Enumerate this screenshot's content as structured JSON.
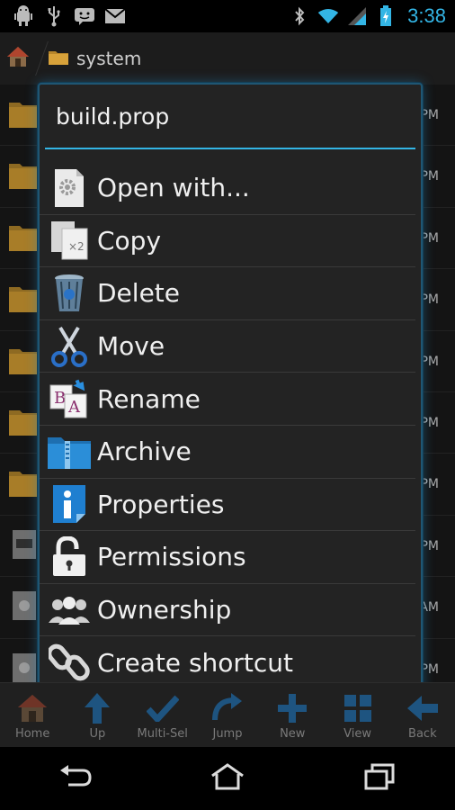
{
  "status_bar": {
    "time": "3:38",
    "icons": [
      "android-debug-icon",
      "usb-icon",
      "messenger-icon",
      "gmail-icon",
      "bluetooth-icon",
      "wifi-icon",
      "signal-icon",
      "battery-charging-icon"
    ]
  },
  "path_bar": {
    "segments": [
      {
        "label": "system",
        "icon": "folder-icon"
      }
    ]
  },
  "file_list": {
    "rows": [
      {
        "time": "PM",
        "type": "folder"
      },
      {
        "time": "PM",
        "type": "folder"
      },
      {
        "time": "PM",
        "type": "folder"
      },
      {
        "time": "PM",
        "type": "folder"
      },
      {
        "time": "PM",
        "type": "folder"
      },
      {
        "time": "PM",
        "type": "folder"
      },
      {
        "time": "PM",
        "type": "folder"
      },
      {
        "time": "PM",
        "type": "file"
      },
      {
        "time": "AM",
        "type": "file"
      },
      {
        "time": "PM",
        "type": "file"
      }
    ]
  },
  "dialog": {
    "title": "build.prop",
    "items": [
      {
        "label": "Open with...",
        "icon": "gear-document-icon"
      },
      {
        "label": "Copy",
        "icon": "copy-icon"
      },
      {
        "label": "Delete",
        "icon": "trash-icon"
      },
      {
        "label": "Move",
        "icon": "scissors-icon"
      },
      {
        "label": "Rename",
        "icon": "rename-icon"
      },
      {
        "label": "Archive",
        "icon": "archive-icon"
      },
      {
        "label": "Properties",
        "icon": "info-icon"
      },
      {
        "label": "Permissions",
        "icon": "unlock-icon"
      },
      {
        "label": "Ownership",
        "icon": "users-icon"
      },
      {
        "label": "Create shortcut",
        "icon": "link-icon"
      }
    ]
  },
  "toolbar": {
    "buttons": [
      {
        "label": "Home",
        "icon": "home-icon"
      },
      {
        "label": "Up",
        "icon": "arrow-up-icon"
      },
      {
        "label": "Multi-Sel",
        "icon": "checkmark-icon"
      },
      {
        "label": "Jump",
        "icon": "jump-icon"
      },
      {
        "label": "New",
        "icon": "plus-icon"
      },
      {
        "label": "View",
        "icon": "grid-icon"
      },
      {
        "label": "Back",
        "icon": "arrow-left-icon"
      }
    ]
  },
  "nav_bar": {
    "buttons": [
      "back-nav-icon",
      "home-nav-icon",
      "recents-nav-icon"
    ]
  },
  "colors": {
    "accent": "#33b5e5",
    "dialog_bg": "#232323",
    "dialog_border": "#1f5673"
  }
}
